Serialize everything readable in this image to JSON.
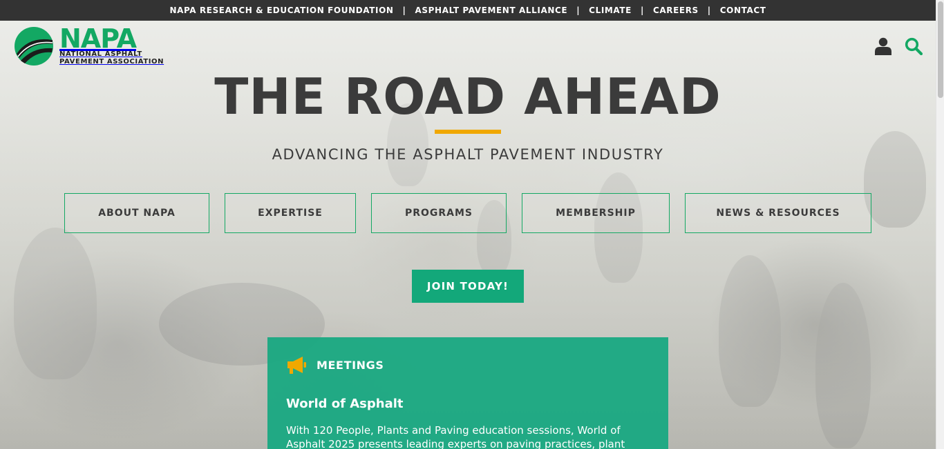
{
  "top_links": [
    "NAPA RESEARCH & EDUCATION FOUNDATION",
    "ASPHALT PAVEMENT ALLIANCE",
    "CLIMATE",
    "CAREERS",
    "CONTACT"
  ],
  "top_separator": "|",
  "logo": {
    "word": "NAPA",
    "line1": "NATIONAL ASPHALT",
    "line2": "PAVEMENT ASSOCIATION"
  },
  "icons": {
    "account": "user-icon",
    "search": "search-icon"
  },
  "hero": {
    "title": "THE ROAD AHEAD",
    "subtitle": "ADVANCING THE ASPHALT PAVEMENT INDUSTRY"
  },
  "nav": [
    "ABOUT NAPA",
    "EXPERTISE",
    "PROGRAMS",
    "MEMBERSHIP",
    "NEWS & RESOURCES"
  ],
  "join_label": "JOIN TODAY!",
  "card": {
    "category": "MEETINGS",
    "title": "World of Asphalt",
    "body": "With 120 People, Plants and Paving education sessions, World of Asphalt 2025 presents leading experts on paving practices, plant"
  },
  "colors": {
    "brand_green": "#13a863",
    "accent_yellow": "#f0a800",
    "topbar": "#333333",
    "card_green": "#16a880"
  }
}
